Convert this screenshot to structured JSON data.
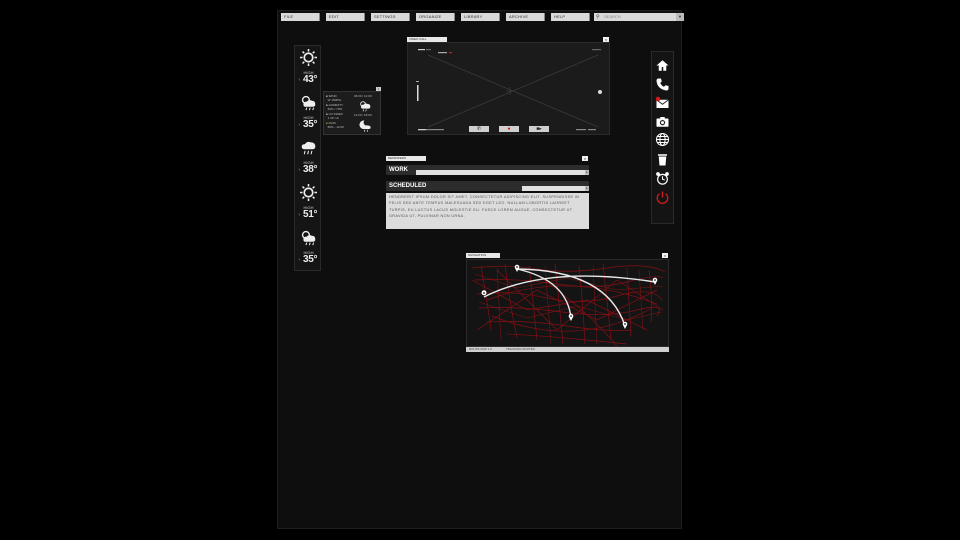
{
  "menu": {
    "items": [
      "FILE",
      "EDIT",
      "SETTINGS",
      "ORGANIZE",
      "LIBRARY",
      "ARCHIVE",
      "HELP"
    ],
    "search_placeholder": "SEARCH"
  },
  "weather": {
    "days": [
      {
        "icon": "sun-icon",
        "label": "HIGH",
        "temp": "43°"
      },
      {
        "icon": "sun-cloud-rain-icon",
        "label": "HIGH",
        "temp": "35°"
      },
      {
        "icon": "rain-cloud-icon",
        "label": "HIGH",
        "temp": "38°"
      },
      {
        "icon": "sun-icon",
        "label": "HIGH",
        "temp": "51°"
      },
      {
        "icon": "sun-cloud-rain-icon",
        "label": "HIGH",
        "temp": "35°"
      }
    ],
    "detail": {
      "rows": [
        {
          "k": "WIND",
          "v": "W 16MPH"
        },
        {
          "k": "HUMIDITY",
          "v": "60% / 70%"
        },
        {
          "k": "UV INDEX",
          "v": "1 OF 10"
        },
        {
          "k": "RAIN",
          "v": "80% - 12:00"
        }
      ],
      "times": [
        "06:00 / 12:00",
        "12:00 / 18:00"
      ]
    }
  },
  "video_call": {
    "title": "VIDEO CALL",
    "status": "CONNECTED",
    "footer_left": "00:00:00",
    "footer_right": "00:00:00"
  },
  "dock": {
    "icons": [
      "home-icon",
      "phone-icon",
      "mail-icon",
      "camera-icon",
      "globe-icon",
      "trash-icon",
      "alarm-clock-icon",
      "power-icon"
    ]
  },
  "tasks": {
    "title": "REMINDERS",
    "rows": [
      {
        "label": "WORK",
        "progress": 0.85
      },
      {
        "label": "SCHEDULED",
        "progress": 0.33
      }
    ],
    "body": "HENDRERIT IPSUM DOLOR SIT AMET, CONSECTETUR ADIPISCING ELIT. SUSPENDISSE IN FELIS SED ANTE TEMPUS MALESUADA SED EGET LEO. NULLAM LOBORTIS LAOREET TURPIS, EU LUCTUS LACUS MOLESTIE EU. FUSCE LOREM AUGUE, CONSECTETUR UT GRAVIDA UT, PULVINAR NON URNA."
  },
  "map": {
    "title": "NAVIGATION",
    "footer_left": "ROUTE MAP 1.0",
    "footer_mid": "TRACKING ROUTES"
  },
  "colors": {
    "accent": "#d11a1a",
    "panel": "#151515"
  }
}
